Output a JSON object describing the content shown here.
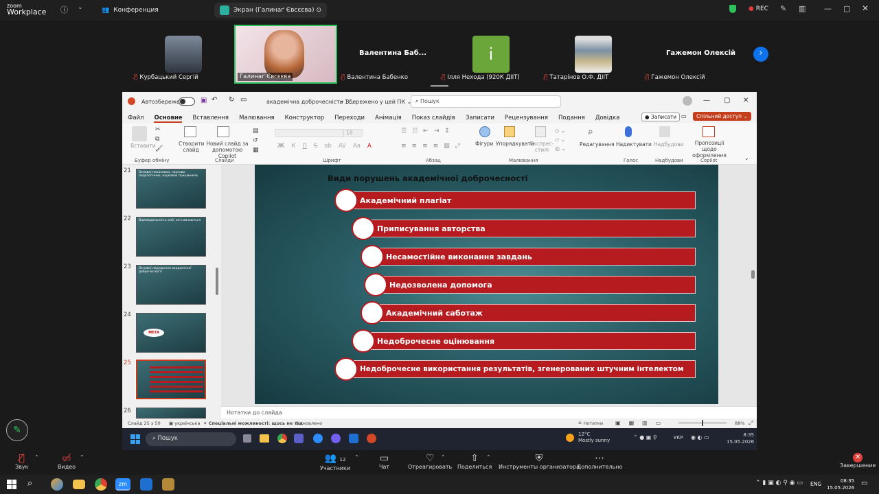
{
  "zoom": {
    "logo_top": "zoom",
    "logo_bottom": "Workplace",
    "tab_conference": "Конференция",
    "tab_screen": "Экран (Галинаґ Євсєєва)",
    "rec": "REC"
  },
  "participants": [
    {
      "name": "Курбацький Сергій"
    },
    {
      "name": "Галинаґ Євсєєва"
    },
    {
      "name": "Валентина Бабенко",
      "big": "Валентина  Баб..."
    },
    {
      "name": "Ілля Нехода (920К ДІІТ)",
      "letter": "i"
    },
    {
      "name": "Татарінов О.Ф. ДІІТ"
    },
    {
      "name": "Гажемон Олексій",
      "big": "Гажемон Олексій"
    }
  ],
  "ppt": {
    "autosave": "Автозбереження",
    "filename": "академічна доброчесність 1...",
    "saved": "• Збережено у цей ПК ⌄",
    "search": "Пошук",
    "record": "Записати",
    "share": "Спільний доступ",
    "menu": [
      "Файл",
      "Основне",
      "Вставлення",
      "Малювання",
      "Конструктор",
      "Переходи",
      "Анімація",
      "Показ слайдів",
      "Записати",
      "Рецензування",
      "Подання",
      "Довідка"
    ],
    "ribbon": {
      "paste": "Вставити",
      "clipboard": "Буфер обміну",
      "new_slide": "Створити слайд",
      "new_slide_copilot": "Новий слайд за допомогою Copilot",
      "slides": "Слайди",
      "font": "Шрифт",
      "font_size": "18",
      "paragraph": "Абзац",
      "shapes": "Фігури",
      "arrange": "Упорядкувати",
      "quick_styles": "Експрес-стилі",
      "drawing": "Малювання",
      "editing": "Редагування",
      "dictate": "Надиктувати",
      "voice": "Голос",
      "addins": "Надбудови",
      "addins_group": "Надбудови",
      "designer": "Пропозиції щодо оформлення",
      "copilot": "Copilot"
    },
    "thumbnails": [
      {
        "num": "21",
        "title": "Основні показники, науково-педагогічних, наукових працівників"
      },
      {
        "num": "22",
        "title": "Відповідальність осіб, які навчаються"
      },
      {
        "num": "23",
        "title": "Основні порушення академічної доброчесності"
      },
      {
        "num": "24",
        "title": "МЕТА"
      },
      {
        "num": "25",
        "title": ""
      },
      {
        "num": "26",
        "title": ""
      }
    ],
    "slide": {
      "title": "Види порушень академічної доброчесності",
      "items": [
        "Академічний плагіат",
        "Приписування авторства",
        "Несамостійне виконання завдань",
        "Недозволена допомога",
        "Академічний саботаж",
        "Недоброчесне оцінювання",
        "Недоброчесне використання результатів, згенерованих штучним інтелектом"
      ]
    },
    "notes": "Нотатки до слайда",
    "status": {
      "slide": "Слайд 25 з 50",
      "lang": "українська",
      "access": "Спеціальні можливості: щось не так",
      "restored": "Відновлено",
      "notes_btn": "Нотатки",
      "zoom": "88%"
    },
    "taskbar": {
      "search": "Пошук",
      "temp": "12°C",
      "weather": "Mostly sunny",
      "lang": "УКР",
      "time": "8:35",
      "date": "15.05.2026"
    }
  },
  "controls": {
    "audio": "Звук",
    "video": "Видео",
    "participants_count": "12",
    "participants": "Участники",
    "chat": "Чат",
    "react": "Отреагировать",
    "share": "Поделиться",
    "host_tools": "Инструменты организатора",
    "more": "Дополнительно",
    "end": "Завершение"
  },
  "windows": {
    "lang": "ENG",
    "time": "08:35",
    "date": "15.05.2026"
  }
}
